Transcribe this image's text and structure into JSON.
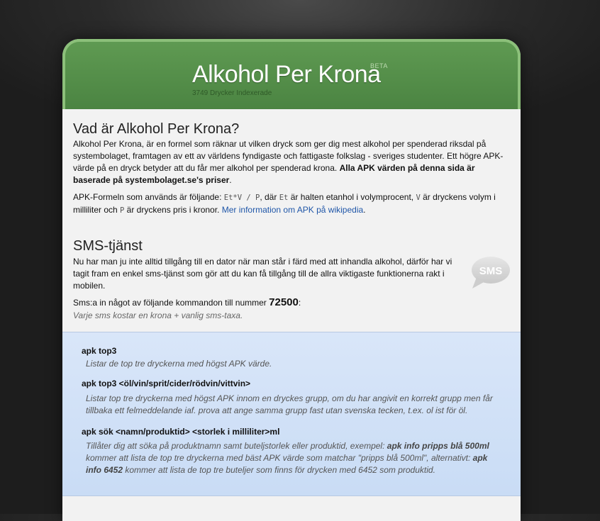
{
  "header": {
    "title": "Alkohol Per Krona",
    "beta": "BETA",
    "count_text": "3749 Drycker Indexerade"
  },
  "about": {
    "heading": "Vad är Alkohol Per Krona?",
    "p1_text": "Alkohol Per Krona, är en formel som räknar ut vilken dryck som ger dig mest alkohol per spenderad riksdal på systembolaget, framtagen av ett av världens fyndigaste och fattigaste folkslag - sveriges studenter. Ett högre APK-värde på en dryck betyder att du får mer alkohol per spenderad krona.",
    "p1_bold": "Alla APK värden på denna sida är baserade på systembolaget.se's priser",
    "p1_end": ".",
    "p2_a": "APK-Formeln som används är följande: ",
    "formula": "Et*V / P",
    "p2_b": ", där ",
    "code_et": "Et",
    "p2_c": " är halten etanhol i volymprocent, ",
    "code_v": "V",
    "p2_d": " är dryckens volym i milliliter och ",
    "code_p": "P",
    "p2_e": " är dryckens pris i kronor. ",
    "link": "Mer information om APK på wikipedia",
    "p2_end": "."
  },
  "sms": {
    "heading": "SMS-tjänst",
    "p3": "Nu har man ju inte alltid tillgång till en dator när man står i färd med att inhandla alkohol, därför har vi tagit fram en enkel sms-tjänst som gör att du kan få tillgång till de allra viktigaste funktionerna rakt i mobilen.",
    "p4_a": "Sms:a in något av följande kommandon till nummer ",
    "number": "72500",
    "p4_b": ":",
    "p5": "Varje sms kostar en krona + vanlig sms-taxa.",
    "bubble_text": "SMS"
  },
  "commands": [
    {
      "name": "apk top3",
      "desc": "Listar de top tre dryckerna med högst APK värde."
    },
    {
      "name": "apk top3 <öl/vin/sprit/cider/rödvin/vittvin>",
      "desc": "Listar top tre dryckerna med högst APK innom en dryckes grupp, om du har angivit en korrekt grupp men får tillbaka ett felmeddelande iaf. prova att ange samma grupp fast utan svenska tecken, t.ex. ol ist för öl."
    },
    {
      "name": "apk sök <namn/produktid> <storlek i milliliter>ml",
      "desc_a": "Tillåter dig att söka på produktnamn samt buteljstorlek eller produktid, exempel: ",
      "desc_b1": "apk info pripps blå 500ml",
      "desc_c": " kommer att lista de top tre dryckerna med bäst APK värde som matchar \"pripps blå 500ml\", alternativt: ",
      "desc_b2": "apk info 6452",
      "desc_d": " kommer att lista de top tre buteljer som finns för drycken med 6452 som produktid."
    }
  ],
  "colors": {
    "header_green": "#5d9550",
    "link_blue": "#1f56a8",
    "commands_bg": "#d9e6f9"
  }
}
